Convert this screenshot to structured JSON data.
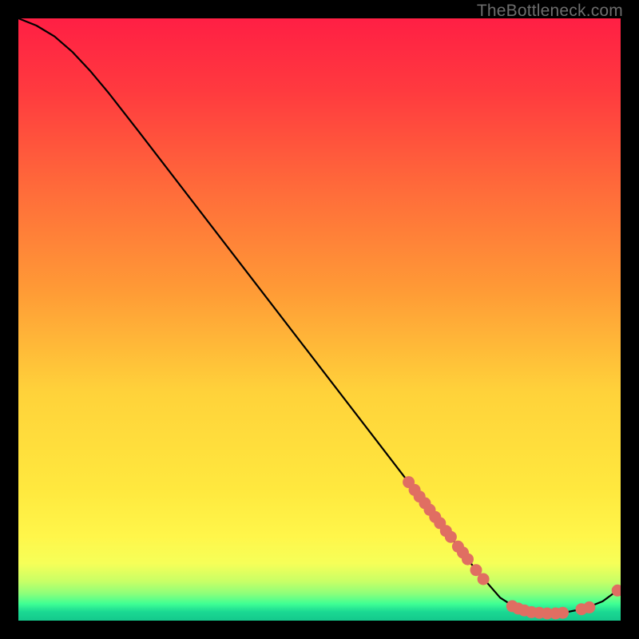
{
  "watermark": "TheBottleneck.com",
  "chart_data": {
    "type": "line",
    "title": "",
    "xlabel": "",
    "ylabel": "",
    "xlim": [
      0,
      100
    ],
    "ylim": [
      0,
      100
    ],
    "gradient_stops": [
      {
        "offset": 0.0,
        "color": "#ff1f44"
      },
      {
        "offset": 0.12,
        "color": "#ff3a3f"
      },
      {
        "offset": 0.28,
        "color": "#ff6a3a"
      },
      {
        "offset": 0.45,
        "color": "#ff9a36"
      },
      {
        "offset": 0.62,
        "color": "#ffd23a"
      },
      {
        "offset": 0.78,
        "color": "#ffe83e"
      },
      {
        "offset": 0.86,
        "color": "#fff64a"
      },
      {
        "offset": 0.905,
        "color": "#f6ff58"
      },
      {
        "offset": 0.935,
        "color": "#c8ff66"
      },
      {
        "offset": 0.955,
        "color": "#8dff7a"
      },
      {
        "offset": 0.972,
        "color": "#3fff94"
      },
      {
        "offset": 0.985,
        "color": "#1bd993"
      },
      {
        "offset": 1.0,
        "color": "#14c98c"
      }
    ],
    "curve": [
      {
        "x": 0.0,
        "y": 100.0
      },
      {
        "x": 3.0,
        "y": 98.8
      },
      {
        "x": 6.0,
        "y": 97.0
      },
      {
        "x": 9.0,
        "y": 94.4
      },
      {
        "x": 12.0,
        "y": 91.2
      },
      {
        "x": 15.0,
        "y": 87.6
      },
      {
        "x": 20.0,
        "y": 81.2
      },
      {
        "x": 30.0,
        "y": 68.2
      },
      {
        "x": 40.0,
        "y": 55.2
      },
      {
        "x": 50.0,
        "y": 42.2
      },
      {
        "x": 60.0,
        "y": 29.2
      },
      {
        "x": 70.0,
        "y": 16.2
      },
      {
        "x": 76.0,
        "y": 8.4
      },
      {
        "x": 80.0,
        "y": 3.8
      },
      {
        "x": 82.5,
        "y": 2.2
      },
      {
        "x": 85.0,
        "y": 1.4
      },
      {
        "x": 88.0,
        "y": 1.2
      },
      {
        "x": 91.0,
        "y": 1.4
      },
      {
        "x": 94.0,
        "y": 2.0
      },
      {
        "x": 97.0,
        "y": 3.2
      },
      {
        "x": 100.0,
        "y": 5.4
      }
    ],
    "markers": [
      {
        "x": 64.8,
        "y": 23.0
      },
      {
        "x": 65.8,
        "y": 21.7
      },
      {
        "x": 66.6,
        "y": 20.6
      },
      {
        "x": 67.5,
        "y": 19.5
      },
      {
        "x": 68.3,
        "y": 18.4
      },
      {
        "x": 69.2,
        "y": 17.2
      },
      {
        "x": 70.0,
        "y": 16.2
      },
      {
        "x": 71.0,
        "y": 14.9
      },
      {
        "x": 71.8,
        "y": 13.9
      },
      {
        "x": 73.0,
        "y": 12.3
      },
      {
        "x": 73.8,
        "y": 11.3
      },
      {
        "x": 74.6,
        "y": 10.2
      },
      {
        "x": 76.0,
        "y": 8.4
      },
      {
        "x": 77.2,
        "y": 6.9
      },
      {
        "x": 82.0,
        "y": 2.4
      },
      {
        "x": 83.0,
        "y": 2.0
      },
      {
        "x": 84.0,
        "y": 1.7
      },
      {
        "x": 85.2,
        "y": 1.4
      },
      {
        "x": 86.5,
        "y": 1.3
      },
      {
        "x": 87.8,
        "y": 1.2
      },
      {
        "x": 89.2,
        "y": 1.2
      },
      {
        "x": 90.4,
        "y": 1.3
      },
      {
        "x": 93.5,
        "y": 1.9
      },
      {
        "x": 94.8,
        "y": 2.2
      },
      {
        "x": 99.5,
        "y": 5.0
      }
    ],
    "marker_color": "#e06e62",
    "line_color": "#000000"
  }
}
